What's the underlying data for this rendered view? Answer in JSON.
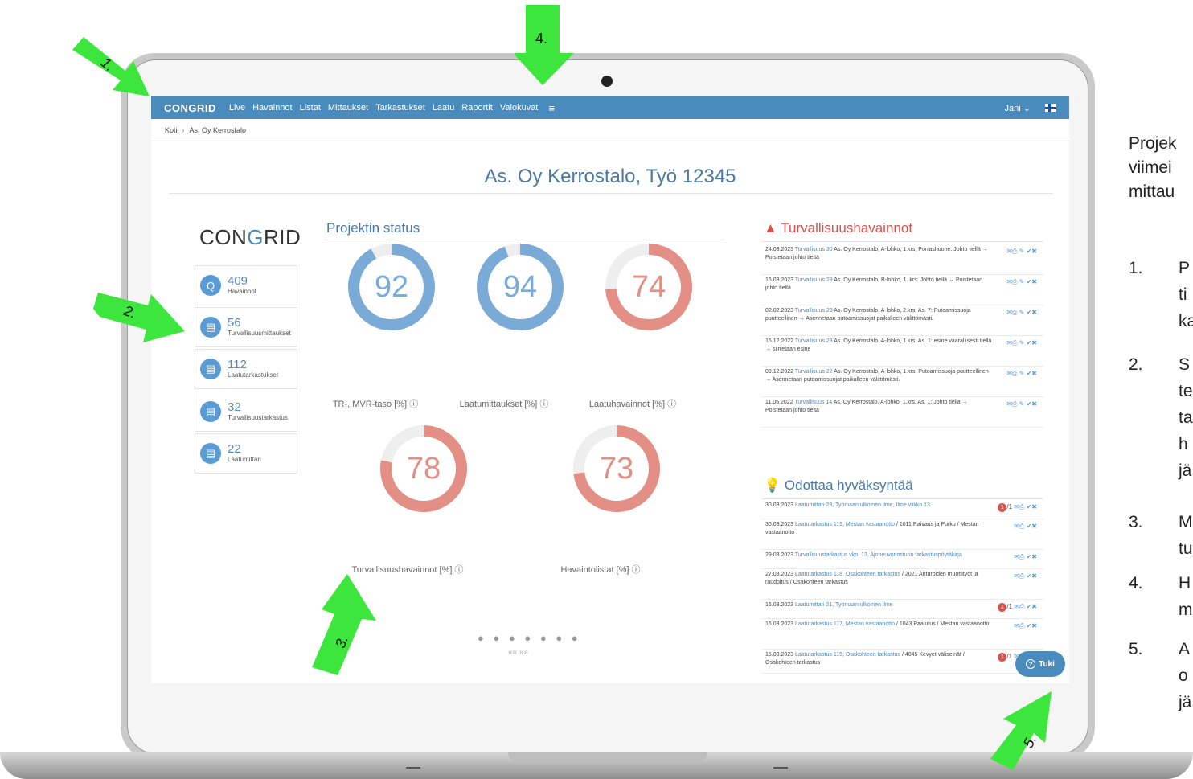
{
  "navbar": {
    "logo": "CONGRID",
    "items": [
      "Live",
      "Havainnot",
      "Listat",
      "Mittaukset",
      "Tarkastukset",
      "Laatu",
      "Raportit",
      "Valokuvat"
    ],
    "menu_icon": "≡",
    "user": "Jani ⌄"
  },
  "breadcrumb": {
    "home": "Koti",
    "sep": "›",
    "current": "As. Oy Kerrostalo"
  },
  "page": {
    "title": "As. Oy Kerrostalo, Työ 12345"
  },
  "brand": {
    "left": "CON",
    "mid": "G",
    "right": "RID"
  },
  "stats": [
    {
      "icon": "magnifier-icon",
      "glyph": "Q",
      "value": "409",
      "label": "Havainnot"
    },
    {
      "icon": "document-icon",
      "glyph": "▤",
      "value": "56",
      "label": "Turvallisuusmittaukset"
    },
    {
      "icon": "document-icon",
      "glyph": "▤",
      "value": "112",
      "label": "Laatutarkastukset"
    },
    {
      "icon": "document-icon",
      "glyph": "▤",
      "value": "32",
      "label": "Turvallisuustarkastus"
    },
    {
      "icon": "document-icon",
      "glyph": "▤",
      "value": "22",
      "label": "Laatumittari"
    }
  ],
  "status": {
    "title": "Projektin status",
    "gauges": [
      {
        "value": "92",
        "percent": 92,
        "label": "TR-, MVR-taso [%] ⓘ",
        "color": "#7aaad6"
      },
      {
        "value": "94",
        "percent": 94,
        "label": "Laatumittaukset [%] ⓘ",
        "color": "#7aaad6"
      },
      {
        "value": "74",
        "percent": 74,
        "label": "Laatuhavainnot [%] ⓘ",
        "color": "#e38f86"
      },
      {
        "value": "78",
        "percent": 78,
        "label": "Turvallisuushavainnot [%] ⓘ",
        "color": "#e38f86"
      },
      {
        "value": "73",
        "percent": 73,
        "label": "Havaintolistat [%] ⓘ",
        "color": "#e38f86"
      }
    ],
    "dots": "● ● ● ● ● ● ●",
    "arrows": "«« »»"
  },
  "safety": {
    "title": "Turvallisuushavainnot",
    "rows": [
      {
        "date": "24.03.2023",
        "link": "Turvallisuus 30",
        "text": "As. Oy Kerrostalo, A-lohko, 1.krs, Porrashuone: Johto tiellä → Poistetaan johto tieltä"
      },
      {
        "date": "16.03.2023",
        "link": "Turvallisuus 29",
        "text": "As. Oy Kerrostalo, B-lohko, 1. krs: Johto tiellä → Poistetaan johto tieltä"
      },
      {
        "date": "02.02.2023",
        "link": "Turvallisuus 28",
        "text": "As. Oy Kerrostalo, A-lohko, 2.krs, As. 7: Putoamissuoja puutteellinen → Asennetaan putoamissuojat paikalleen välittömästi."
      },
      {
        "date": "15.12.2022",
        "link": "Turvallisuus 23",
        "text": "As. Oy Kerrostalo, A-lohko, 1.krs, As. 1: esine vaarallisesti tiellä → siirretaan esine"
      },
      {
        "date": "09.12.2022",
        "link": "Turvallisuus 22",
        "text": "As. Oy Kerrostalo, A-lohko, 1.krs: Putoamissuoja puutteellinen → Asennetaan putoamissuojat paikalleen välittömästi."
      },
      {
        "date": "11.05.2022",
        "link": "Turvallisuus 14",
        "text": "As. Oy Kerrostalo, A-lohko, 1.krs, As. 1: Johto tiellä → Poistetaan johto tieltä"
      }
    ],
    "actions": "✉⎙ ✎ ✔✖"
  },
  "approval": {
    "title": "Odottaa hyväksyntää",
    "rows": [
      {
        "date": "30.03.2023",
        "link": "Laatumittari 23, Työmaan ulkoinen ilme, Ilme viikko 13",
        "text": "",
        "badge": "1",
        "count": "/1"
      },
      {
        "date": "30.03.2023",
        "link": "Laatutarkastus 119, Mestan vastaanotto",
        "text": "/ 1011 Raivaus ja Purku / Mestan vastaanotto",
        "badge": "",
        "count": ""
      },
      {
        "date": "29.03.2023",
        "link": "Turvallisuustarkastus vko. 13, Ajoneuvonosturin tarkastuspöytäkirja",
        "text": "",
        "badge": "",
        "count": ""
      },
      {
        "date": "27.03.2023",
        "link": "Laatutarkastus 118, Osakohteen tarkastus",
        "text": "/ 2021 Anturoiden muottityöt ja raudoitus / Osakohteen tarkastus",
        "badge": "",
        "count": ""
      },
      {
        "date": "16.03.2023",
        "link": "Laatumittari 21, Työmaan ulkoinen ilme",
        "text": "",
        "badge": "1",
        "count": "/1"
      },
      {
        "date": "16.03.2023",
        "link": "Laatutarkastus 117, Mestan vastaanotto",
        "text": "/ 1043 Paalutus / Mestan vastaanotto",
        "badge": "",
        "count": ""
      },
      {
        "date": "15.03.2023",
        "link": "Laatutarkastus 115, Osakohteen tarkastus",
        "text": "/ 4045 Kevyet väliseinät / Osakohteen tarkastus",
        "badge": "1",
        "count": "/1"
      }
    ],
    "actions": "✉⎙ ✔✖"
  },
  "support": {
    "label": "Tuki",
    "icon": "?"
  },
  "annotations": {
    "arrow_color": "#3de63d",
    "labels": [
      "1.",
      "2.",
      "3.",
      "4.",
      "5."
    ]
  },
  "side_text": {
    "lines": [
      "Projek",
      "viimei",
      "mittau"
    ],
    "items": [
      {
        "num": "1.",
        "lines": [
          "P",
          "ti",
          "ka"
        ]
      },
      {
        "num": "2.",
        "lines": [
          "S",
          "te",
          "ta",
          "h",
          "jä"
        ]
      },
      {
        "num": "3.",
        "lines": [
          "M",
          "tu"
        ]
      },
      {
        "num": "4.",
        "lines": [
          "H",
          "m"
        ]
      },
      {
        "num": "5.",
        "lines": [
          "A",
          "o",
          "jä"
        ]
      }
    ]
  }
}
